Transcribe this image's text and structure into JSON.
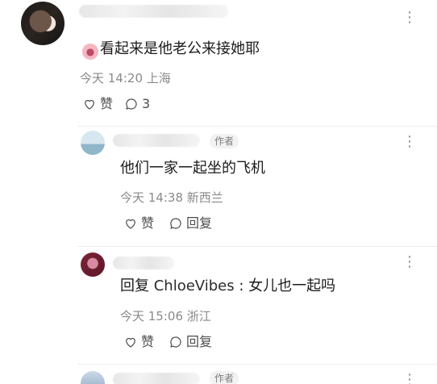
{
  "main_comment": {
    "text": "看起来是他老公来接她耶",
    "meta": "今天 14:20 上海",
    "like_label": "赞",
    "comment_count": "3"
  },
  "replies": [
    {
      "author_tag": "作者",
      "text": "他们一家一起坐的飞机",
      "meta": "今天 14:38 新西兰",
      "like_label": "赞",
      "reply_label": "回复"
    },
    {
      "text_prefix": "回复 ",
      "reply_to": "ChloeVibes",
      "text_suffix": " : 女儿也一起吗",
      "meta": "今天 15:06 浙江",
      "like_label": "赞",
      "reply_label": "回复"
    },
    {
      "author_tag": "作者"
    }
  ],
  "icons": {
    "emoji": "peach-face-icon",
    "like": "heart-icon",
    "comment": "comment-bubble-icon",
    "more": "more-dots-icon"
  }
}
